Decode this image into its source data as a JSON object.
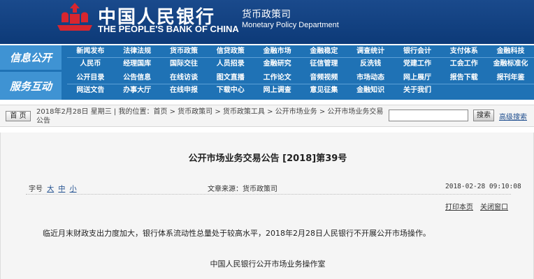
{
  "header": {
    "bank_cn": "中国人民银行",
    "bank_en": "THE PEOPLE'S BANK OF CHINA",
    "dept_cn": "货币政策司",
    "dept_en": "Monetary Policy Department",
    "logo_icon": "pboc-emblem-icon"
  },
  "nav": {
    "group1": {
      "title": "信息公开",
      "row1": [
        "新闻发布",
        "法律法规",
        "货币政策",
        "信贷政策",
        "金融市场",
        "金融稳定",
        "调查统计",
        "银行会计",
        "支付体系",
        "金融科技"
      ],
      "row2": [
        "人民币",
        "经理国库",
        "国际交往",
        "人员招录",
        "金融研究",
        "征信管理",
        "反洗钱",
        "党建工作",
        "工会工作",
        "金融标准化"
      ]
    },
    "group2": {
      "title": "服务互动",
      "row1": [
        "公开目录",
        "公告信息",
        "在线访谈",
        "图文直播",
        "工作论文",
        "音频视频",
        "市场动态",
        "网上展厅",
        "报告下载",
        "报刊年鉴"
      ],
      "row2": [
        "网送文告",
        "办事大厅",
        "在线申报",
        "下载中心",
        "网上调查",
        "意见征集",
        "金融知识",
        "关于我们"
      ]
    }
  },
  "breadcrumb": {
    "home_label": "首 页",
    "text": "2018年2月28日 星期三 | 我的位置：首页 > 货币政策司 > 货币政策工具 > 公开市场业务 > 公开市场业务交易公告",
    "search_value": "",
    "search_button": "搜索",
    "advanced_search": "高级搜索"
  },
  "article": {
    "title": "公开市场业务交易公告 [2018]第39号",
    "font_size_label": "字号",
    "size_large": "大",
    "size_medium": "中",
    "size_small": "小",
    "source": "文章来源：货币政策司",
    "datetime": "2018-02-28 09:10:08",
    "print_label": "打印本页",
    "close_label": "关闭窗口",
    "body": "临近月末财政支出力度加大，银行体系流动性总量处于较高水平，2018年2月28日人民银行不开展公开市场操作。",
    "signature": "中国人民银行公开市场业务操作室"
  },
  "colors": {
    "header_bg": "#0d3a78",
    "nav_bg": "#1f72b5",
    "nav_title_bg": "#3f93d3",
    "logo_red": "#d8262f"
  }
}
